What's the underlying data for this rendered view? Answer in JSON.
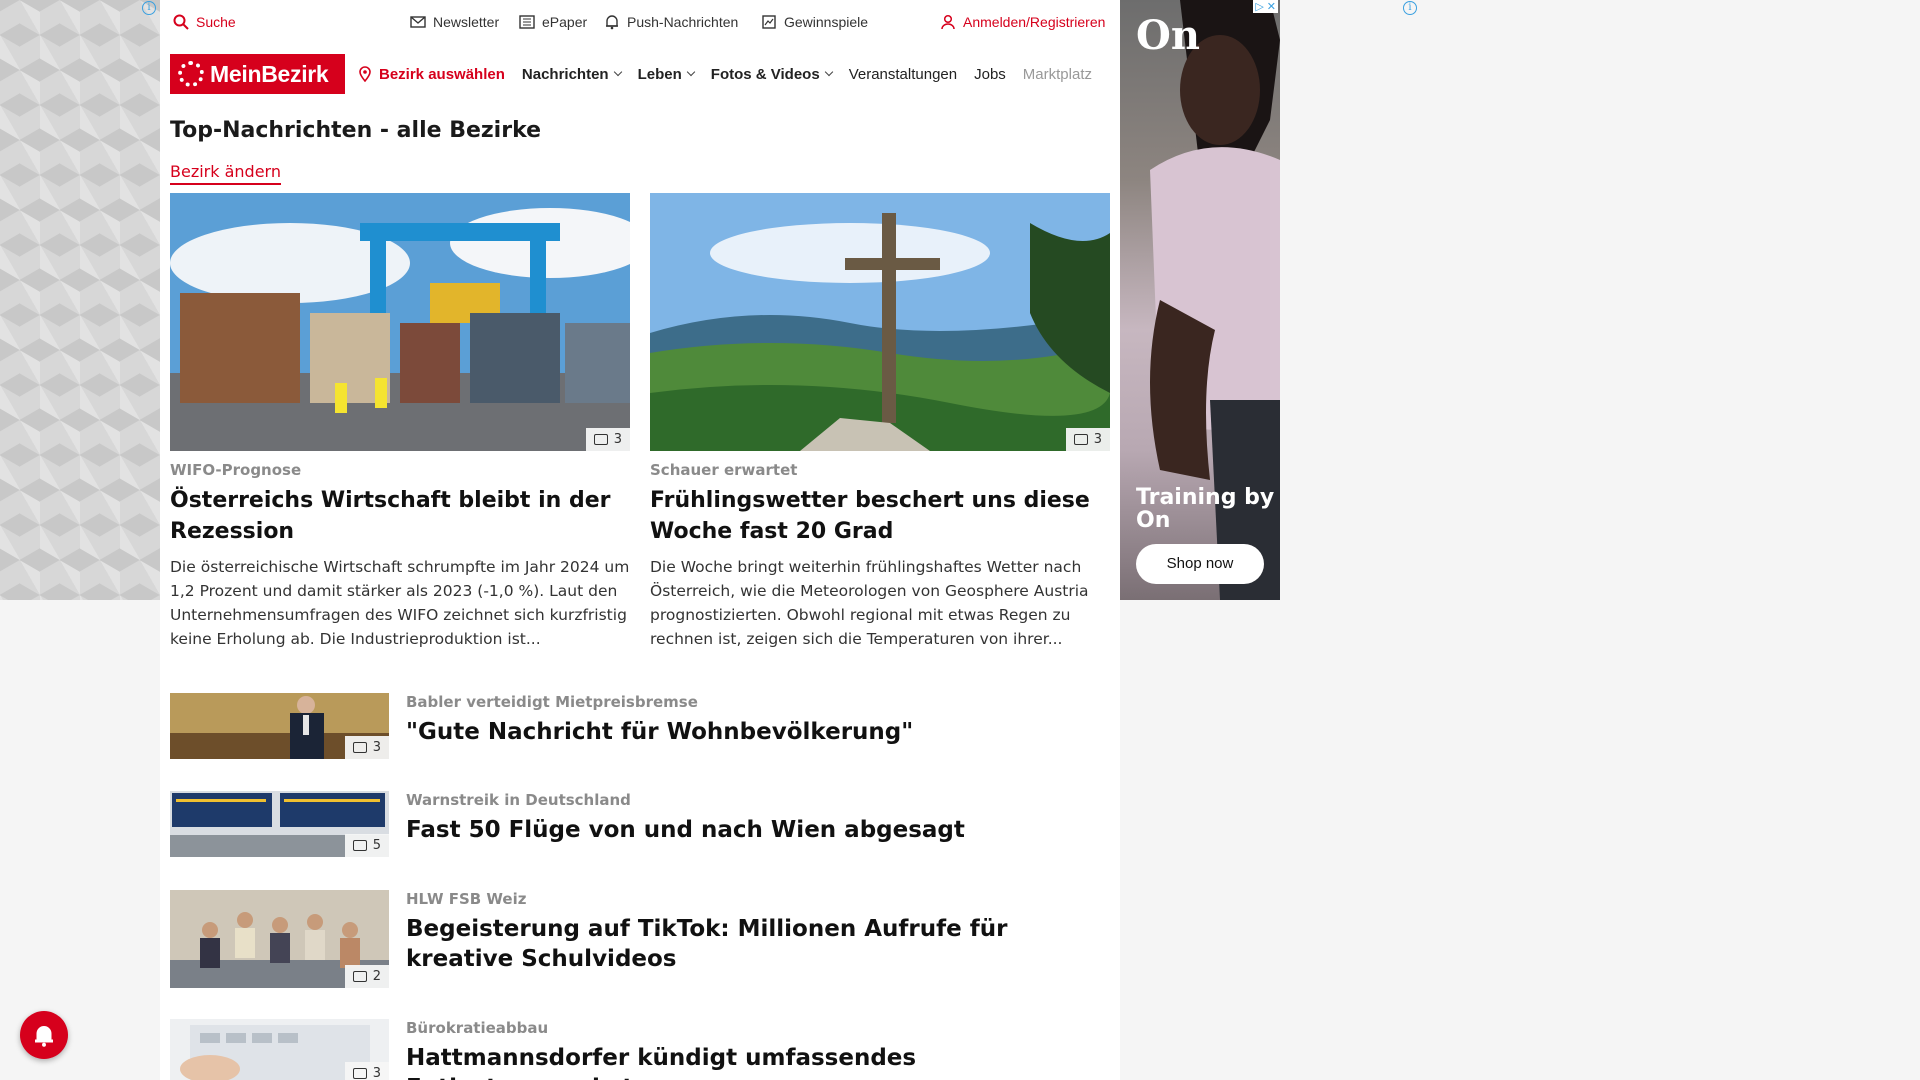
{
  "topbar": {
    "search": "Suche",
    "newsletter": "Newsletter",
    "epaper": "ePaper",
    "push": "Push-Nachrichten",
    "gewinnspiele": "Gewinnspiele",
    "login": "Anmelden/Registrieren"
  },
  "nav": {
    "logo": "MeinBezirk",
    "location": "Bezirk auswählen",
    "items": [
      "Nachrichten",
      "Leben",
      "Fotos & Videos",
      "Veranstaltungen",
      "Jobs",
      "Marktplatz"
    ]
  },
  "section": {
    "title": "Top-Nachrichten - alle Bezirke",
    "change": "Bezirk ändern"
  },
  "featured": [
    {
      "kicker": "WIFO-Prognose",
      "headline": "Österreichs Wirtschaft bleibt in der Rezession",
      "teaser": "Die österreichische Wirtschaft schrumpfte im Jahr 2024 um 1,2 Prozent und damit stärker als 2023 (-1,0 %). Laut den Unternehmensumfragen des WIFO zeichnet sich kurzfristig keine Erholung ab. Die Industrieproduktion ist...",
      "photos": "3"
    },
    {
      "kicker": "Schauer erwartet",
      "headline": "Frühlingswetter beschert uns diese Woche fast 20 Grad",
      "teaser": "Die Woche bringt weiterhin frühlingshaftes Wetter nach Österreich, wie die Meteorologen von Geosphere Austria prognostizierten. Obwohl regional mit etwas Regen zu rechnen ist, zeigen sich die Temperaturen von ihrer...",
      "photos": "3"
    }
  ],
  "list": [
    {
      "kicker": "Babler verteidigt Mietpreisbremse",
      "headline": "\"Gute Nachricht für Wohnbevölkerung\"",
      "photos": "3"
    },
    {
      "kicker": "Warnstreik in Deutschland",
      "headline": "Fast 50 Flüge von und nach Wien abgesagt",
      "photos": "5"
    },
    {
      "kicker": "HLW FSB Weiz",
      "headline": "Begeisterung auf TikTok: Millionen Aufrufe für kreative Schulvideos",
      "photos": "2"
    },
    {
      "kicker": "Bürokratieabbau",
      "headline": "Hattmannsdorfer kündigt umfassendes Entlastungspaket an",
      "photos": "3"
    }
  ],
  "ad": {
    "brand": "On",
    "text": "Training by On",
    "button": "Shop now"
  },
  "colors": {
    "brand_red": "#d6001c"
  }
}
